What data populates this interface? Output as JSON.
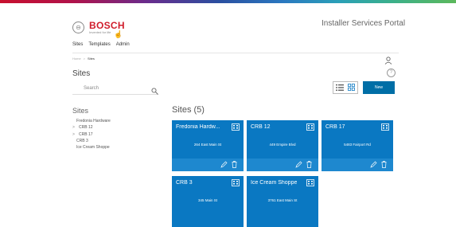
{
  "header": {
    "brand": "BOSCH",
    "tagline": "Invented for life",
    "portal_title": "Installer Services Portal"
  },
  "nav": {
    "items": [
      "Sites",
      "Templates",
      "Admin"
    ]
  },
  "breadcrumb": {
    "home": "Home",
    "separator": ">",
    "current": "Sites"
  },
  "page": {
    "title": "Sites",
    "search_placeholder": "Search",
    "new_label": "New"
  },
  "sidebar": {
    "title": "Sites",
    "items": [
      {
        "label": "Fredonia Hardware",
        "expandable": false
      },
      {
        "label": "CRB 12",
        "expandable": true
      },
      {
        "label": "CRB 17",
        "expandable": true
      },
      {
        "label": "CRB 3",
        "expandable": false
      },
      {
        "label": "Ice Cream Shoppe",
        "expandable": false
      }
    ]
  },
  "main": {
    "title": "Sites (5)",
    "cards": [
      {
        "name": "Fredonia Hardw...",
        "address": "264 East Main St"
      },
      {
        "name": "CRB 12",
        "address": "449 Empire Blvd"
      },
      {
        "name": "CRB 17",
        "address": "5483 Fairport Rd"
      },
      {
        "name": "CRB 3",
        "address": "345 Main St"
      },
      {
        "name": "Ice Cream Shoppe",
        "address": "3761 East Main St"
      }
    ]
  },
  "colors": {
    "card": "#0a78c2",
    "card_footer": "#1e88cf",
    "button": "#006ea6",
    "brand_red": "#d01c2b"
  }
}
